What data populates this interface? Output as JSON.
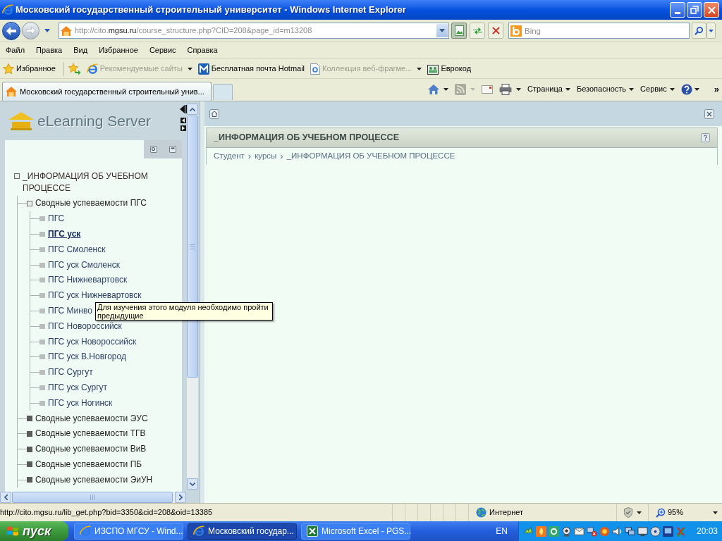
{
  "window": {
    "title": "Московский государственный строительный университет - Windows Internet Explorer"
  },
  "address_bar": {
    "url_prefix": "http://cito.",
    "url_domain": "mgsu.ru",
    "url_path": "/course_structure.php?CID=208&page_id=m13208"
  },
  "search": {
    "placeholder": "Bing"
  },
  "menu": [
    "Файл",
    "Правка",
    "Вид",
    "Избранное",
    "Сервис",
    "Справка"
  ],
  "favorites_bar": {
    "favorites_button": "Избранное",
    "links": [
      {
        "kind": "ie",
        "label": "Рекомендуемые сайты",
        "disabled": true,
        "dropdown": true
      },
      {
        "kind": "hotmail",
        "label": "Бесплатная почта Hotmail",
        "disabled": false,
        "dropdown": false
      },
      {
        "kind": "page",
        "label": "Коллекция веб-фрагме...",
        "disabled": true,
        "dropdown": true
      },
      {
        "kind": "card",
        "label": "Еврокод",
        "disabled": false,
        "dropdown": false
      }
    ]
  },
  "tabs": [
    {
      "label": "Московский государственный строительный унив...",
      "selected": true
    }
  ],
  "command_bar": {
    "menus": [
      "Страница",
      "Безопасность",
      "Сервис"
    ],
    "overflow": "»"
  },
  "sidebar": {
    "logo": "eLearning Server",
    "tree": [
      {
        "label": "_ИНФОРМАЦИЯ ОБ УЧЕБНОМ ПРОЦЕССЕ",
        "expanded": true,
        "children": [
          {
            "label": "Сводные успеваемости ПГС",
            "expanded": true,
            "children": [
              {
                "label": "ПГС",
                "selected": false
              },
              {
                "label": "ПГС уск",
                "selected": true
              },
              {
                "label": "ПГС Смоленск",
                "selected": false
              },
              {
                "label": "ПГС уск Смоленск",
                "selected": false
              },
              {
                "label": "ПГС Нижневартовск",
                "selected": false
              },
              {
                "label": "ПГС уск Нижневартовск",
                "selected": false
              },
              {
                "label": "ПГС Минво",
                "selected": false
              },
              {
                "label": "ПГС Новороссийск",
                "selected": false
              },
              {
                "label": "ПГС уск Новороссийск",
                "selected": false
              },
              {
                "label": "ПГС уск В.Новгород",
                "selected": false
              },
              {
                "label": "ПГС Сургут",
                "selected": false
              },
              {
                "label": "ПГС уск Сургут",
                "selected": false
              },
              {
                "label": "ПГС уск Ногинск",
                "selected": false
              }
            ]
          },
          {
            "label": "Сводные успеваемости ЭУС",
            "expanded": false
          },
          {
            "label": "Сводные успеваемости ТГВ",
            "expanded": false
          },
          {
            "label": "Сводные успеваемости ВиВ",
            "expanded": false
          },
          {
            "label": "Сводные успеваемости ПБ",
            "expanded": false
          },
          {
            "label": "Сводные успеваемости ЭиУН",
            "expanded": false
          }
        ]
      }
    ]
  },
  "tooltip": {
    "text": "Для изучения этого модуля необходимо пройти предыдущие"
  },
  "content": {
    "title": "_ИНФОРМАЦИЯ ОБ УЧЕБНОМ ПРОЦЕССЕ",
    "breadcrumb": [
      {
        "kind": "link",
        "text": "Студент"
      },
      {
        "kind": "separator",
        "text": "›"
      },
      {
        "kind": "link",
        "text": "курсы"
      },
      {
        "kind": "separator",
        "text": "›"
      },
      {
        "kind": "current",
        "text": "_ИНФОРМАЦИЯ ОБ УЧЕБНОМ ПРОЦЕССЕ"
      }
    ]
  },
  "status_bar": {
    "url": "http://cito.mgsu.ru/lib_get.php?bid=3350&cid=208&oid=13385",
    "zone": "Интернет",
    "zoom": "95%"
  },
  "taskbar": {
    "start": "пуск",
    "tasks": [
      {
        "kind": "ie",
        "label": "ИЗСПО МГСУ - Wind...",
        "selected": false
      },
      {
        "kind": "ie",
        "label": "Московский государ...",
        "selected": true
      },
      {
        "kind": "excel",
        "label": "Microsoft Excel - PGS...",
        "selected": false
      }
    ],
    "language": "EN",
    "clock": "20:03"
  }
}
